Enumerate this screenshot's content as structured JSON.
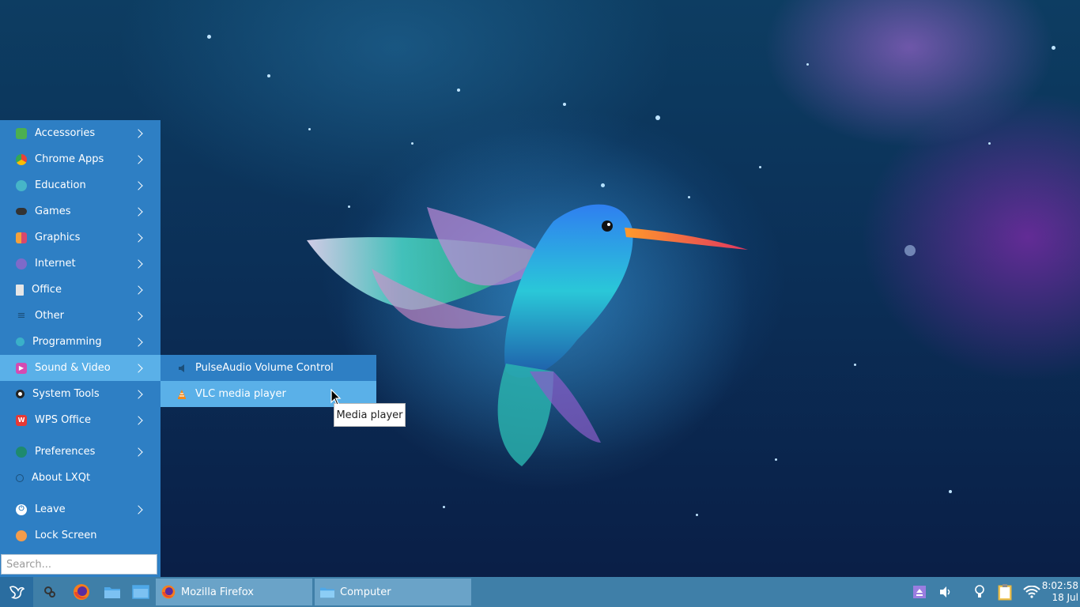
{
  "menu": {
    "items": [
      {
        "label": "Accessories",
        "icon": "accessories-icon",
        "color": "#4caf50",
        "submenu": true
      },
      {
        "label": "Chrome Apps",
        "icon": "chrome-icon",
        "color": "#e94235",
        "submenu": true
      },
      {
        "label": "Education",
        "icon": "education-icon",
        "color": "#46b5c8",
        "submenu": true
      },
      {
        "label": "Games",
        "icon": "gamepad-icon",
        "color": "#333333",
        "submenu": true
      },
      {
        "label": "Graphics",
        "icon": "graphics-icon",
        "color": "#f4a13b",
        "submenu": true
      },
      {
        "label": "Internet",
        "icon": "internet-icon",
        "color": "#7e6ac9",
        "submenu": true
      },
      {
        "label": "Office",
        "icon": "office-icon",
        "color": "#e6e6e6",
        "submenu": true
      },
      {
        "label": "Other",
        "icon": "other-icon",
        "color": "#1b4f7a",
        "submenu": true
      },
      {
        "label": "Programming",
        "icon": "programming-icon",
        "color": "#3ab0c8",
        "submenu": true
      },
      {
        "label": "Sound & Video",
        "icon": "sound-video-icon",
        "color": "#d54ab2",
        "submenu": true,
        "active": true
      },
      {
        "label": "System Tools",
        "icon": "system-tools-icon",
        "color": "#222222",
        "submenu": true
      },
      {
        "label": "WPS Office",
        "icon": "wps-icon",
        "color": "#e53935",
        "submenu": true
      },
      {
        "label": "Preferences",
        "icon": "preferences-icon",
        "color": "#1e8a6e",
        "submenu": true
      },
      {
        "label": "About LXQt",
        "icon": "info-icon",
        "color": "#1b4f7a",
        "submenu": false
      },
      {
        "label": "Leave",
        "icon": "power-icon",
        "color": "#ffffff",
        "submenu": true
      },
      {
        "label": "Lock Screen",
        "icon": "lock-icon",
        "color": "#f39c4b",
        "submenu": false
      }
    ],
    "search_placeholder": "Search..."
  },
  "submenu": {
    "items": [
      {
        "label": "PulseAudio Volume Control",
        "icon": "speaker-icon"
      },
      {
        "label": "VLC media player",
        "icon": "vlc-icon",
        "hover": true
      }
    ]
  },
  "tooltip": "Media player",
  "taskbar": {
    "tasks": [
      {
        "label": "Mozilla Firefox",
        "icon": "firefox-icon"
      },
      {
        "label": "Computer",
        "icon": "folder-icon"
      }
    ],
    "clock_time": "8:02:58",
    "clock_date": "18 Jul"
  }
}
